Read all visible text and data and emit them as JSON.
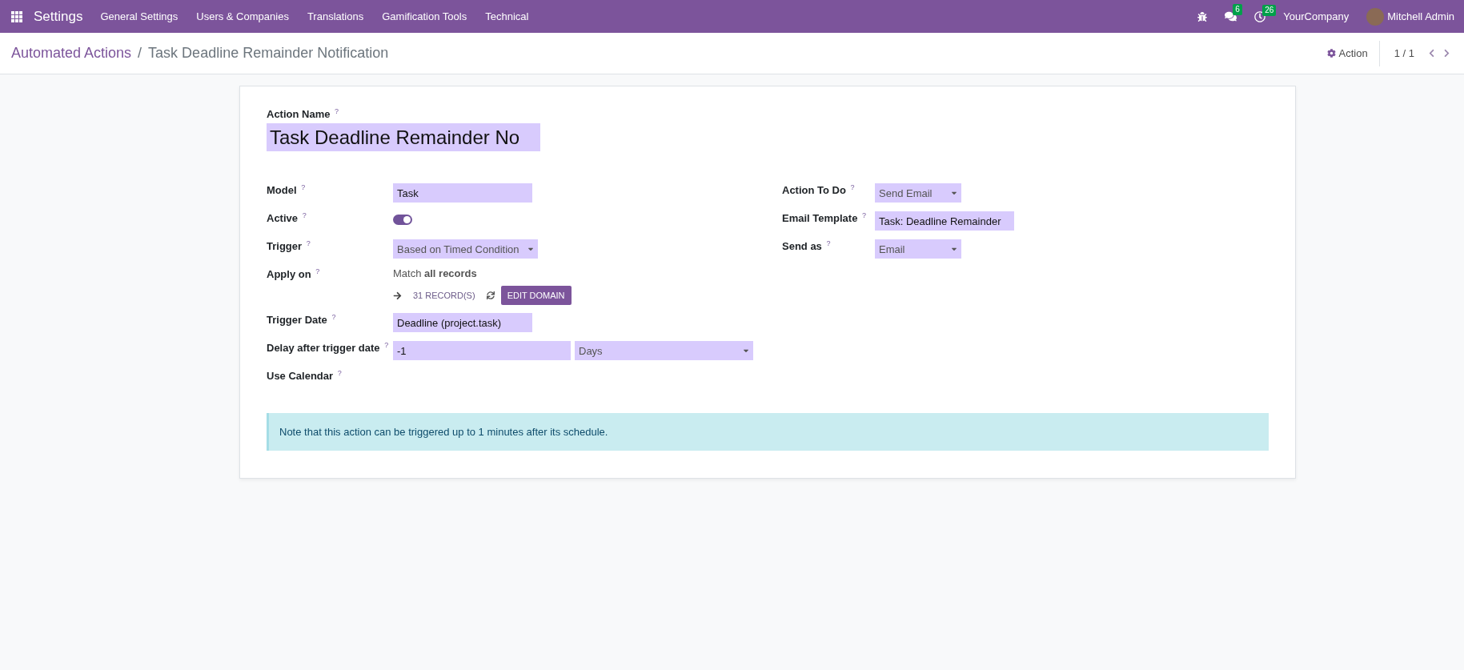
{
  "navbar": {
    "app_title": "Settings",
    "menu": [
      "General Settings",
      "Users & Companies",
      "Translations",
      "Gamification Tools",
      "Technical"
    ],
    "messages_count": "6",
    "activities_count": "26",
    "company": "YourCompany",
    "user": "Mitchell Admin"
  },
  "control_panel": {
    "breadcrumb": "Automated Actions",
    "separator": "/",
    "current": "Task Deadline Remainder Notification",
    "action": "Action",
    "pager": "1 / 1"
  },
  "form": {
    "name_label": "Action Name $^{?}$",
    "name_value": "Task Deadline Remainder No",
    "left": [
      {
        "kind": "input",
        "label": "Model $^{?}$",
        "value": "Task"
      },
      {
        "kind": "toggle",
        "label": "Active $^{?}$",
        "on": true
      },
      {
        "kind": "select",
        "label": "Trigger $^{?}$",
        "value": "Based on Timed Condition"
      },
      {
        "kind": "domain",
        "label": "Apply on $^{?}$",
        "match": "Match **all records**",
        "records": "31 RECORD(S)",
        "button": "EDIT DOMAIN"
      },
      {
        "kind": "input",
        "label": "Trigger Date $^{?}$",
        "value": "Deadline (project.task)"
      },
      {
        "kind": "pair",
        "label": "Delay after trigger date $^{?}$",
        "value": "-1",
        "unit": "Days"
      },
      {
        "kind": "empty",
        "label": "Use Calendar $^{?}$"
      }
    ],
    "right": [
      {
        "kind": "select",
        "label": "Action To Do $^{?}$",
        "value": "Send Email"
      },
      {
        "kind": "input",
        "label": "Email Template $^{?}$",
        "value": "Task: Deadline Remainder"
      },
      {
        "kind": "select",
        "label": "Send as $^{?}$",
        "value": "Email"
      }
    ],
    "note": "Note that this action can be triggered up to 1 minutes after its schedule."
  }
}
